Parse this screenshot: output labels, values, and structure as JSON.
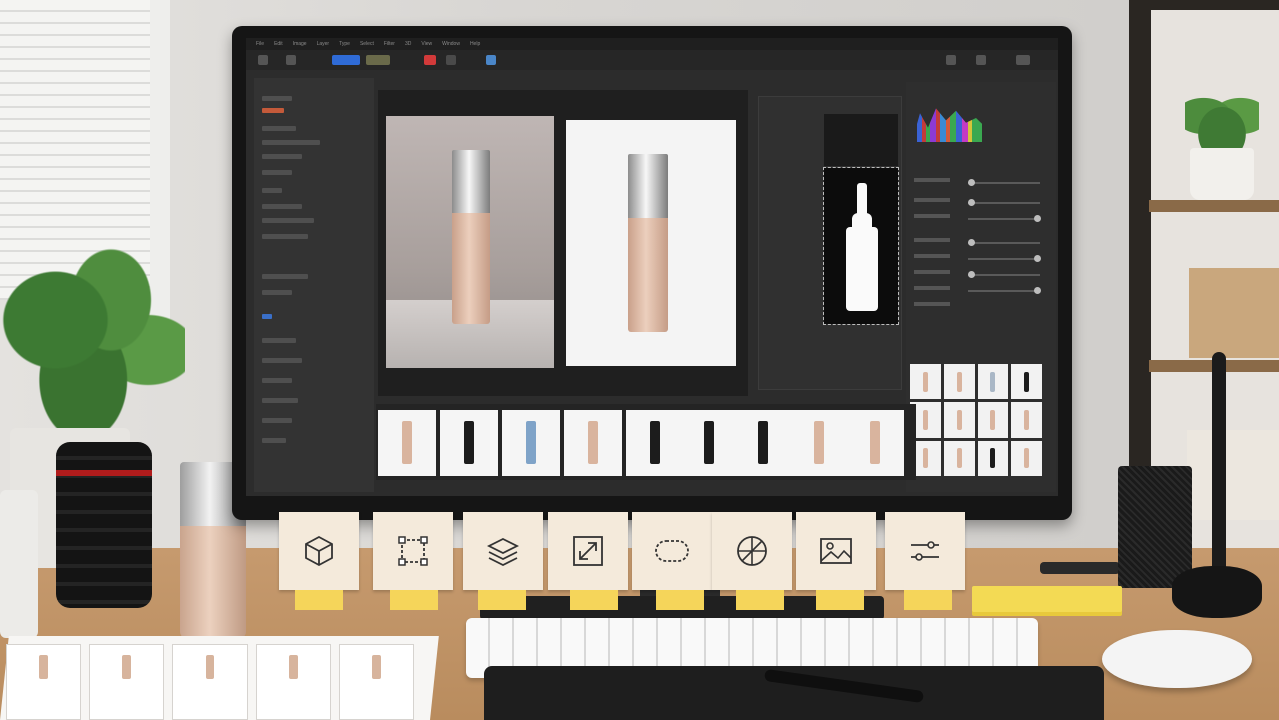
{
  "app": {
    "menu": [
      "File",
      "Edit",
      "Image",
      "Layer",
      "Type",
      "Select",
      "Filter",
      "3D",
      "View",
      "Window",
      "Help"
    ]
  },
  "toolbar": {
    "buttons": [
      "move-tool",
      "select-tool",
      "crop-tool",
      "brush-tool",
      "eraser-tool",
      "zoom-tool"
    ],
    "accent_color": "#2f6bd6",
    "record_color": "#d23a3a"
  },
  "canvas": {
    "photos": [
      "product-photo-original",
      "product-photo-white-background"
    ]
  },
  "filmstrip": {
    "thumbnail_colors": [
      "#d9b49e",
      "#1c1c1c",
      "#7fa3c8",
      "#d9b49e",
      "#1c1c1c",
      "#1c1c1c",
      "#1c1c1c",
      "#d9b49e",
      "#d9b49e"
    ]
  },
  "swatches": {
    "colors": [
      "#d9b49e",
      "#d9b49e",
      "#a9b7c6",
      "#1c1c1c",
      "#d9b49e",
      "#d9b49e",
      "#d9b49e",
      "#d9b49e",
      "#d9b49e",
      "#d9b49e",
      "#1c1c1c",
      "#d9b49e"
    ]
  },
  "sticky_notes": [
    {
      "icon": "cube-icon"
    },
    {
      "icon": "selection-frame-icon"
    },
    {
      "icon": "layers-icon"
    },
    {
      "icon": "resize-arrow-icon"
    },
    {
      "icon": "lasso-icon"
    },
    {
      "icon": "crosshair-icon"
    },
    {
      "icon": "image-icon"
    },
    {
      "icon": "sliders-icon"
    }
  ],
  "sticky_colors": {
    "note": "#f4eadb",
    "tab": "#f5d55a"
  }
}
